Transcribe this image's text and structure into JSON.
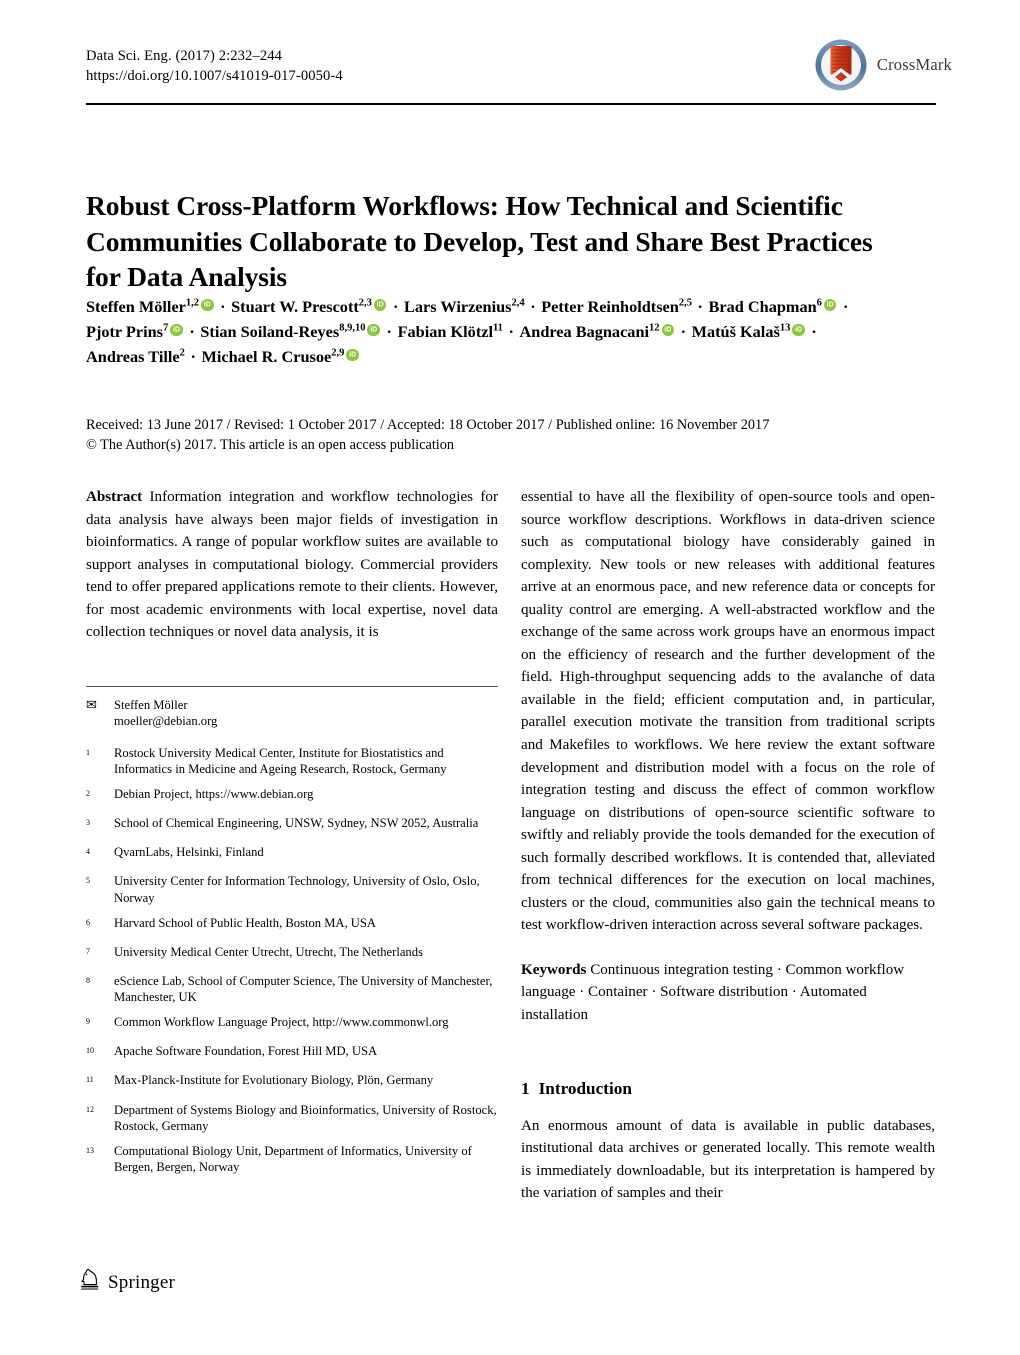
{
  "header": {
    "journal_citation": "Data Sci. Eng. (2017) 2:232–244",
    "doi": "https://doi.org/10.1007/s41019-017-0050-4",
    "crossmark_label": "CrossMark",
    "crossmark_icon": "crossmark-logo-icon"
  },
  "title": "Robust Cross-Platform Workflows: How Technical and Scientific Communities Collaborate to Develop, Test and Share Best Practices for Data Analysis",
  "authors": [
    {
      "name": "Steffen Möller",
      "affiliations": "1,2",
      "orcid": true
    },
    {
      "name": "Stuart W. Prescott",
      "affiliations": "2,3",
      "orcid": true
    },
    {
      "name": "Lars Wirzenius",
      "affiliations": "2,4",
      "orcid": false
    },
    {
      "name": "Petter Reinholdtsen",
      "affiliations": "2,5",
      "orcid": false
    },
    {
      "name": "Brad Chapman",
      "affiliations": "6",
      "orcid": true
    },
    {
      "name": "Pjotr Prins",
      "affiliations": "7",
      "orcid": true
    },
    {
      "name": "Stian Soiland-Reyes",
      "affiliations": "8,9,10",
      "orcid": true
    },
    {
      "name": "Fabian Klötzl",
      "affiliations": "11",
      "orcid": false
    },
    {
      "name": "Andrea Bagnacani",
      "affiliations": "12",
      "orcid": true
    },
    {
      "name": "Matúš Kalaš",
      "affiliations": "13",
      "orcid": true
    },
    {
      "name": "Andreas Tille",
      "affiliations": "2",
      "orcid": false
    },
    {
      "name": "Michael R. Crusoe",
      "affiliations": "2,9",
      "orcid": true
    }
  ],
  "dates": {
    "line1": "Received: 13 June 2017 / Revised: 1 October 2017 / Accepted: 18 October 2017 / Published online: 16 November 2017",
    "line2": "© The Author(s) 2017. This article is an open access publication"
  },
  "abstract": {
    "label": "Abstract",
    "col_left": "Information integration and workflow technologies for data analysis have always been major fields of investigation in bioinformatics. A range of popular workflow suites are available to support analyses in computational biology. Commercial providers tend to offer prepared applications remote to their clients. However, for most academic environments with local expertise, novel data collection techniques or novel data analysis, it is",
    "col_right": "essential to have all the flexibility of open-source tools and open-source workflow descriptions. Workflows in data-driven science such as computational biology have considerably gained in complexity. New tools or new releases with additional features arrive at an enormous pace, and new reference data or concepts for quality control are emerging. A well-abstracted workflow and the exchange of the same across work groups have an enormous impact on the efficiency of research and the further development of the field. High-throughput sequencing adds to the avalanche of data available in the field; efficient computation and, in particular, parallel execution motivate the transition from traditional scripts and Makefiles to workflows. We here review the extant software development and distribution model with a focus on the role of integration testing and discuss the effect of common workflow language on distributions of open-source scientific software to swiftly and reliably provide the tools demanded for the execution of such formally described workflows. It is contended that, alleviated from technical differences for the execution on local machines, clusters or the cloud, communities also gain the technical means to test workflow-driven interaction across several software packages."
  },
  "keywords": {
    "label": "Keywords",
    "text": "Continuous integration testing · Common workflow language · Container · Software distribution · Automated installation"
  },
  "section": {
    "number": "1",
    "heading": "Introduction",
    "paragraph": "An enormous amount of data is available in public databases, institutional data archives or generated locally. This remote wealth is immediately downloadable, but its interpretation is hampered by the variation of samples and their"
  },
  "correspondence": {
    "envelope_icon": "envelope-icon",
    "name": "Steffen Möller",
    "email": "moeller@debian.org"
  },
  "affiliations": [
    {
      "num": "1",
      "text": "Rostock University Medical Center, Institute for Biostatistics and Informatics in Medicine and Ageing Research, Rostock, Germany"
    },
    {
      "num": "2",
      "text": "Debian Project, https://www.debian.org"
    },
    {
      "num": "3",
      "text": "School of Chemical Engineering, UNSW, Sydney, NSW 2052, Australia"
    },
    {
      "num": "4",
      "text": "QvarnLabs, Helsinki, Finland"
    },
    {
      "num": "5",
      "text": "University Center for Information Technology, University of Oslo, Oslo, Norway"
    },
    {
      "num": "6",
      "text": "Harvard School of Public Health, Boston MA, USA"
    },
    {
      "num": "7",
      "text": "University Medical Center Utrecht, Utrecht, The Netherlands"
    },
    {
      "num": "8",
      "text": "eScience Lab, School of Computer Science, The University of Manchester, Manchester, UK"
    },
    {
      "num": "9",
      "text": "Common Workflow Language Project, http://www.commonwl.org"
    },
    {
      "num": "10",
      "text": "Apache Software Foundation, Forest Hill MD, USA"
    },
    {
      "num": "11",
      "text": "Max-Planck-Institute for Evolutionary Biology, Plön, Germany"
    },
    {
      "num": "12",
      "text": "Department of Systems Biology and Bioinformatics, University of Rostock, Rostock, Germany"
    },
    {
      "num": "13",
      "text": "Computational Biology Unit, Department of Informatics, University of Bergen, Bergen, Norway"
    }
  ],
  "footer": {
    "publisher": "Springer",
    "logo_icon": "springer-knight-icon"
  },
  "colors": {
    "orcid_green": "#8cc63f",
    "crossmark_blue": "#5b7fa6",
    "crossmark_red": "#c8371d",
    "text": "#000000"
  }
}
